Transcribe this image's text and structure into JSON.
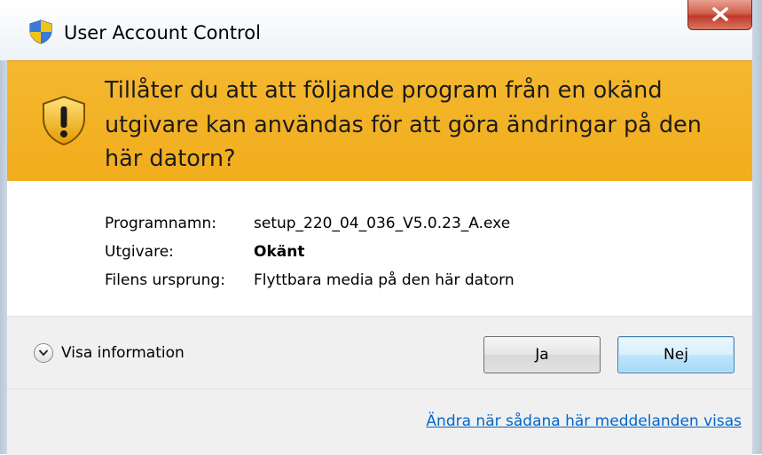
{
  "window": {
    "title": "User Account Control"
  },
  "banner": {
    "question": "Tillåter du att att följande program från en okänd utgivare kan användas för att göra ändringar på den här datorn?"
  },
  "details": {
    "program_name": {
      "label": "Programnamn:",
      "value": "setup_220_04_036_V5.0.23_A.exe"
    },
    "publisher": {
      "label": "Utgivare:",
      "value": "Okänt"
    },
    "file_origin": {
      "label": "Filens ursprung:",
      "value": "Flyttbara media på den här datorn"
    }
  },
  "actions": {
    "show_details_label": "Visa information",
    "yes_label": "Ja",
    "no_label": "Nej"
  },
  "footer": {
    "link_label": "Ändra när sådana här meddelanden visas"
  },
  "colors": {
    "banner": "#f1ad1c",
    "link": "#0066cc",
    "close_button": "#c0392b"
  },
  "icons": {
    "title": "uac-shield-icon",
    "banner": "warning-shield-icon",
    "expand": "chevron-down-icon",
    "close": "close-icon"
  }
}
